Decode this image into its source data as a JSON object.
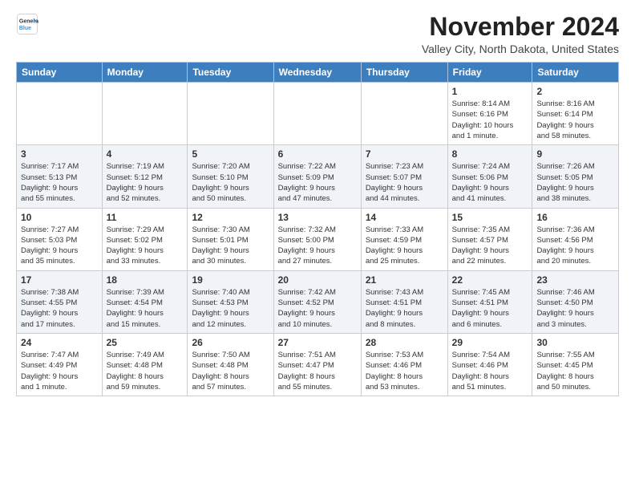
{
  "header": {
    "logo_line1": "General",
    "logo_line2": "Blue",
    "month_title": "November 2024",
    "location": "Valley City, North Dakota, United States"
  },
  "weekdays": [
    "Sunday",
    "Monday",
    "Tuesday",
    "Wednesday",
    "Thursday",
    "Friday",
    "Saturday"
  ],
  "weeks": [
    [
      {
        "day": "",
        "info": ""
      },
      {
        "day": "",
        "info": ""
      },
      {
        "day": "",
        "info": ""
      },
      {
        "day": "",
        "info": ""
      },
      {
        "day": "",
        "info": ""
      },
      {
        "day": "1",
        "info": "Sunrise: 8:14 AM\nSunset: 6:16 PM\nDaylight: 10 hours\nand 1 minute."
      },
      {
        "day": "2",
        "info": "Sunrise: 8:16 AM\nSunset: 6:14 PM\nDaylight: 9 hours\nand 58 minutes."
      }
    ],
    [
      {
        "day": "3",
        "info": "Sunrise: 7:17 AM\nSunset: 5:13 PM\nDaylight: 9 hours\nand 55 minutes."
      },
      {
        "day": "4",
        "info": "Sunrise: 7:19 AM\nSunset: 5:12 PM\nDaylight: 9 hours\nand 52 minutes."
      },
      {
        "day": "5",
        "info": "Sunrise: 7:20 AM\nSunset: 5:10 PM\nDaylight: 9 hours\nand 50 minutes."
      },
      {
        "day": "6",
        "info": "Sunrise: 7:22 AM\nSunset: 5:09 PM\nDaylight: 9 hours\nand 47 minutes."
      },
      {
        "day": "7",
        "info": "Sunrise: 7:23 AM\nSunset: 5:07 PM\nDaylight: 9 hours\nand 44 minutes."
      },
      {
        "day": "8",
        "info": "Sunrise: 7:24 AM\nSunset: 5:06 PM\nDaylight: 9 hours\nand 41 minutes."
      },
      {
        "day": "9",
        "info": "Sunrise: 7:26 AM\nSunset: 5:05 PM\nDaylight: 9 hours\nand 38 minutes."
      }
    ],
    [
      {
        "day": "10",
        "info": "Sunrise: 7:27 AM\nSunset: 5:03 PM\nDaylight: 9 hours\nand 35 minutes."
      },
      {
        "day": "11",
        "info": "Sunrise: 7:29 AM\nSunset: 5:02 PM\nDaylight: 9 hours\nand 33 minutes."
      },
      {
        "day": "12",
        "info": "Sunrise: 7:30 AM\nSunset: 5:01 PM\nDaylight: 9 hours\nand 30 minutes."
      },
      {
        "day": "13",
        "info": "Sunrise: 7:32 AM\nSunset: 5:00 PM\nDaylight: 9 hours\nand 27 minutes."
      },
      {
        "day": "14",
        "info": "Sunrise: 7:33 AM\nSunset: 4:59 PM\nDaylight: 9 hours\nand 25 minutes."
      },
      {
        "day": "15",
        "info": "Sunrise: 7:35 AM\nSunset: 4:57 PM\nDaylight: 9 hours\nand 22 minutes."
      },
      {
        "day": "16",
        "info": "Sunrise: 7:36 AM\nSunset: 4:56 PM\nDaylight: 9 hours\nand 20 minutes."
      }
    ],
    [
      {
        "day": "17",
        "info": "Sunrise: 7:38 AM\nSunset: 4:55 PM\nDaylight: 9 hours\nand 17 minutes."
      },
      {
        "day": "18",
        "info": "Sunrise: 7:39 AM\nSunset: 4:54 PM\nDaylight: 9 hours\nand 15 minutes."
      },
      {
        "day": "19",
        "info": "Sunrise: 7:40 AM\nSunset: 4:53 PM\nDaylight: 9 hours\nand 12 minutes."
      },
      {
        "day": "20",
        "info": "Sunrise: 7:42 AM\nSunset: 4:52 PM\nDaylight: 9 hours\nand 10 minutes."
      },
      {
        "day": "21",
        "info": "Sunrise: 7:43 AM\nSunset: 4:51 PM\nDaylight: 9 hours\nand 8 minutes."
      },
      {
        "day": "22",
        "info": "Sunrise: 7:45 AM\nSunset: 4:51 PM\nDaylight: 9 hours\nand 6 minutes."
      },
      {
        "day": "23",
        "info": "Sunrise: 7:46 AM\nSunset: 4:50 PM\nDaylight: 9 hours\nand 3 minutes."
      }
    ],
    [
      {
        "day": "24",
        "info": "Sunrise: 7:47 AM\nSunset: 4:49 PM\nDaylight: 9 hours\nand 1 minute."
      },
      {
        "day": "25",
        "info": "Sunrise: 7:49 AM\nSunset: 4:48 PM\nDaylight: 8 hours\nand 59 minutes."
      },
      {
        "day": "26",
        "info": "Sunrise: 7:50 AM\nSunset: 4:48 PM\nDaylight: 8 hours\nand 57 minutes."
      },
      {
        "day": "27",
        "info": "Sunrise: 7:51 AM\nSunset: 4:47 PM\nDaylight: 8 hours\nand 55 minutes."
      },
      {
        "day": "28",
        "info": "Sunrise: 7:53 AM\nSunset: 4:46 PM\nDaylight: 8 hours\nand 53 minutes."
      },
      {
        "day": "29",
        "info": "Sunrise: 7:54 AM\nSunset: 4:46 PM\nDaylight: 8 hours\nand 51 minutes."
      },
      {
        "day": "30",
        "info": "Sunrise: 7:55 AM\nSunset: 4:45 PM\nDaylight: 8 hours\nand 50 minutes."
      }
    ]
  ]
}
